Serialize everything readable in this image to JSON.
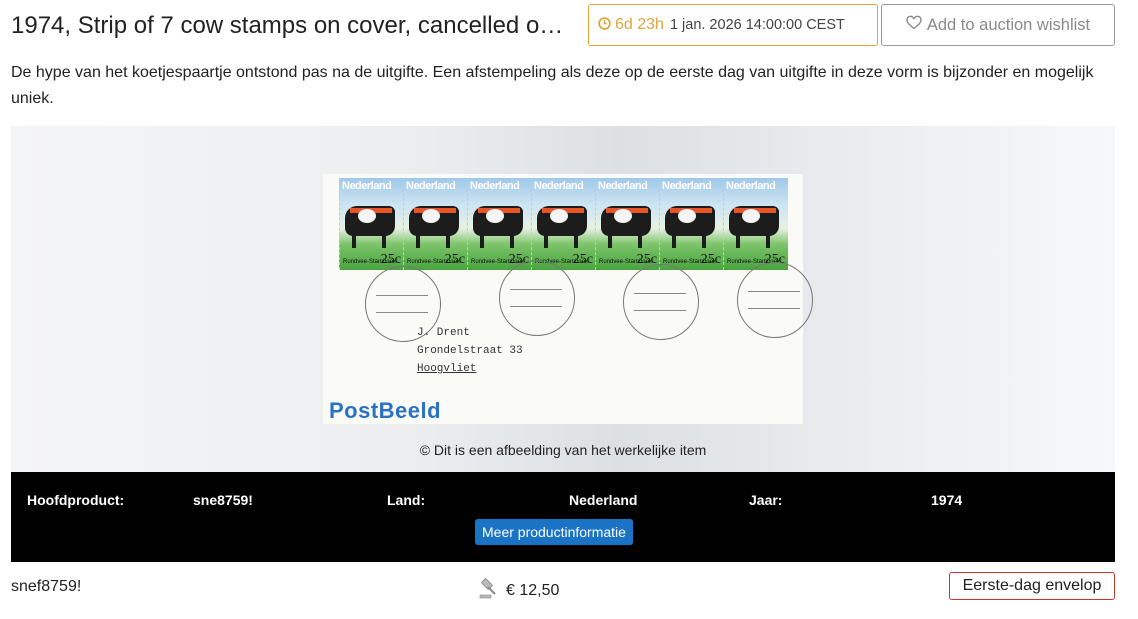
{
  "header": {
    "title": "1974, Strip of 7 cow stamps on cover, cancelled o…",
    "timer_remaining": "6d 23h",
    "timer_end": "1 jan. 2026 14:00:00 CEST",
    "wishlist_label": "Add to auction wishlist"
  },
  "description": "De hype van het koetjespaartje ontstond pas na de uitgifte. Een afstempeling als deze op de eerste dag van uitgifte in deze vorm is bijzonder en mogelijk uniek.",
  "image": {
    "stamp_country": "Nederland",
    "stamp_value": "25c",
    "stamp_small_text": "Rundvee-Stamboek",
    "address_lines": [
      "J. Drent",
      "Grondelstraat 33",
      "Hoogvliet"
    ],
    "logo": "PostBeeld",
    "caption": "© Dit is een afbeelding van het werkelijke item"
  },
  "info": {
    "main_product_label": "Hoofdproduct:",
    "main_product_value": "sne8759!",
    "country_label": "Land:",
    "country_value": "Nederland",
    "year_label": "Jaar:",
    "year_value": "1974",
    "more_button": "Meer productinformatie"
  },
  "footer": {
    "sku": "snef8759!",
    "price": "€ 12,50",
    "badge": "Eerste-dag envelop"
  },
  "colors": {
    "timer_accent": "#e0a43a",
    "button_blue": "#1a73c5",
    "badge_border": "#c0392b"
  }
}
